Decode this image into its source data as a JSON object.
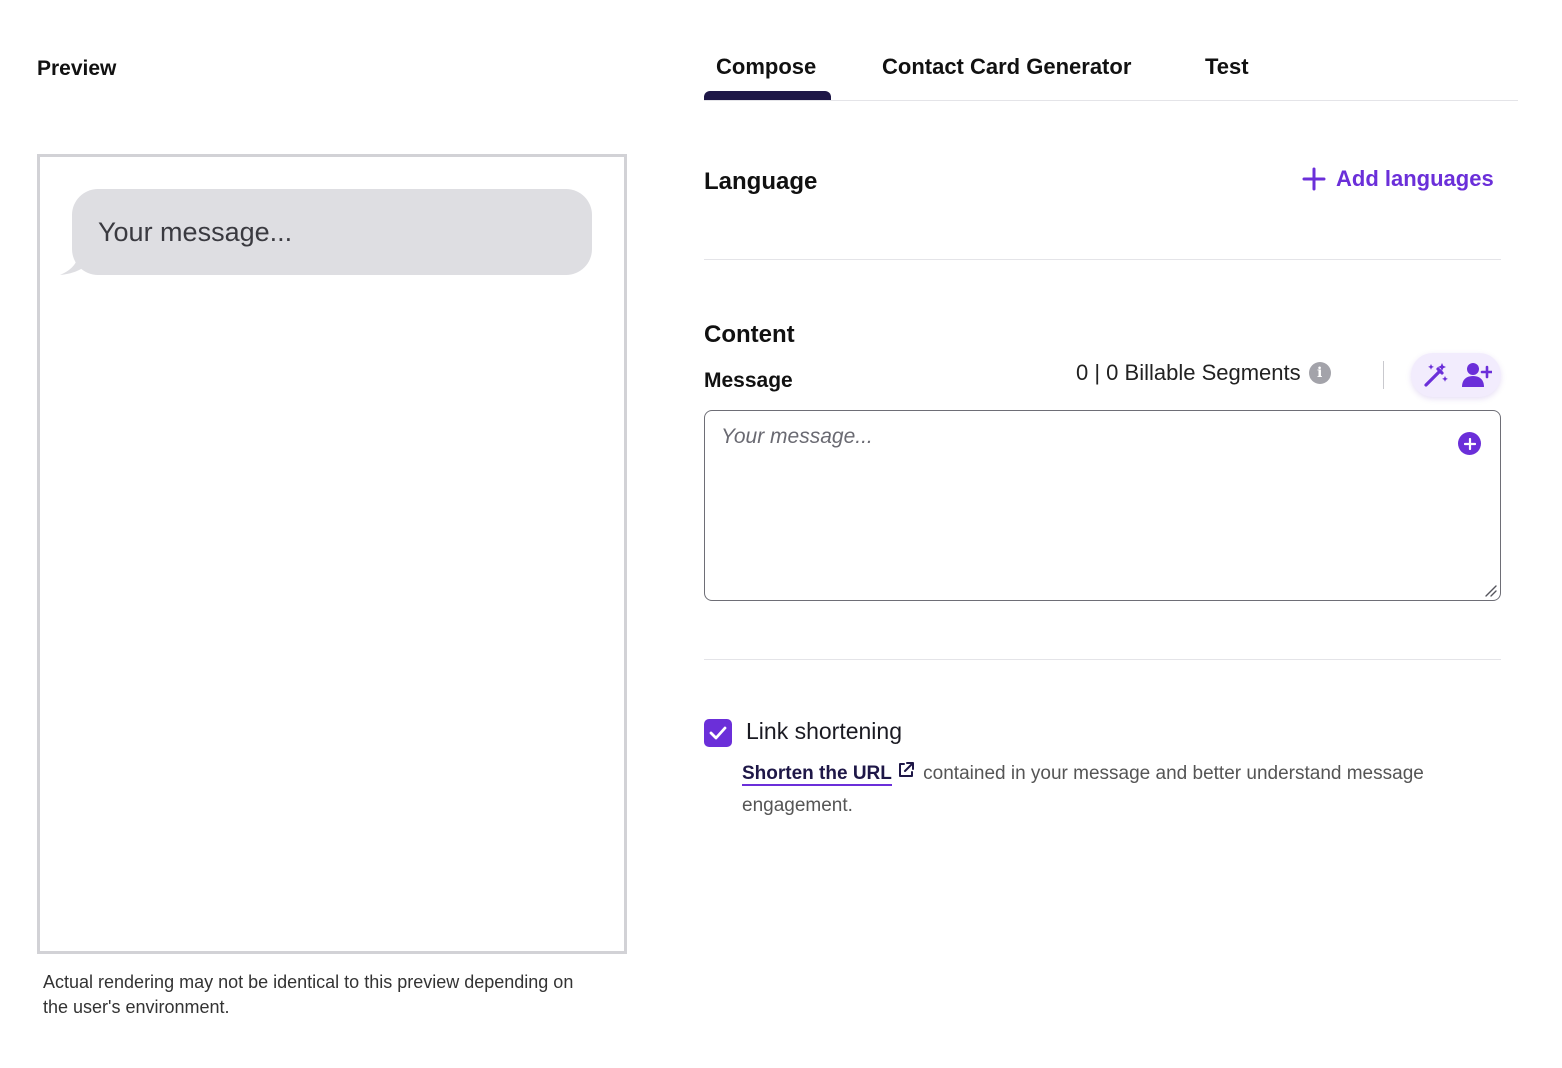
{
  "preview": {
    "title": "Preview",
    "bubble_text": "Your message...",
    "note": "Actual rendering may not be identical to this preview depending on the user's environment."
  },
  "tabs": [
    {
      "label": "Compose",
      "active": true
    },
    {
      "label": "Contact Card Generator",
      "active": false
    },
    {
      "label": "Test",
      "active": false
    }
  ],
  "language": {
    "heading": "Language",
    "add_label": "Add languages",
    "add_icon": "plus-icon"
  },
  "content": {
    "heading": "Content",
    "message_label": "Message",
    "segments_text": "0 | 0 Billable Segments",
    "info_icon": "info-icon",
    "tools": [
      "magic-wand-icon",
      "add-person-icon"
    ],
    "message_placeholder": "Your message...",
    "message_value": ""
  },
  "link_shortening": {
    "label": "Link shortening",
    "checked": true,
    "link_text": "Shorten the URL",
    "description": "contained in your message and better understand message engagement."
  },
  "colors": {
    "accent": "#6b2fd9",
    "tab_indicator": "#1e1747",
    "bubble": "#dedee2"
  }
}
